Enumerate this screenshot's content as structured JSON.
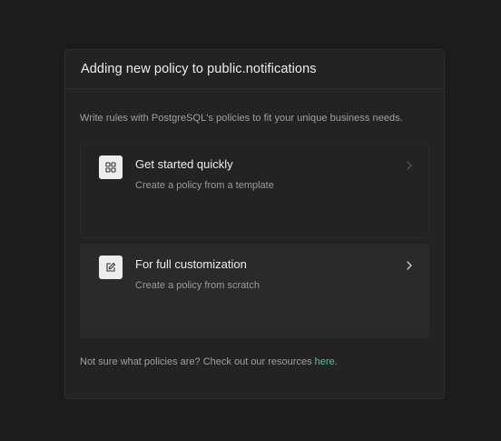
{
  "modal": {
    "title": "Adding new policy to public.notifications",
    "description": "Write rules with PostgreSQL's policies to fit your unique business needs.",
    "options": [
      {
        "title": "Get started quickly",
        "subtitle": "Create a policy from a template",
        "icon": "grid-icon"
      },
      {
        "title": "For full customization",
        "subtitle": "Create a policy from scratch",
        "icon": "edit-icon"
      }
    ],
    "footer": {
      "text": "Not sure what policies are? Check out our resources ",
      "link_label": "here",
      "trailing": "."
    }
  },
  "colors": {
    "background": "#1c1c1c",
    "panel": "#232323",
    "accent_link": "#3ecf8e",
    "text_primary": "#ededed",
    "text_secondary": "#a0a0a0"
  }
}
